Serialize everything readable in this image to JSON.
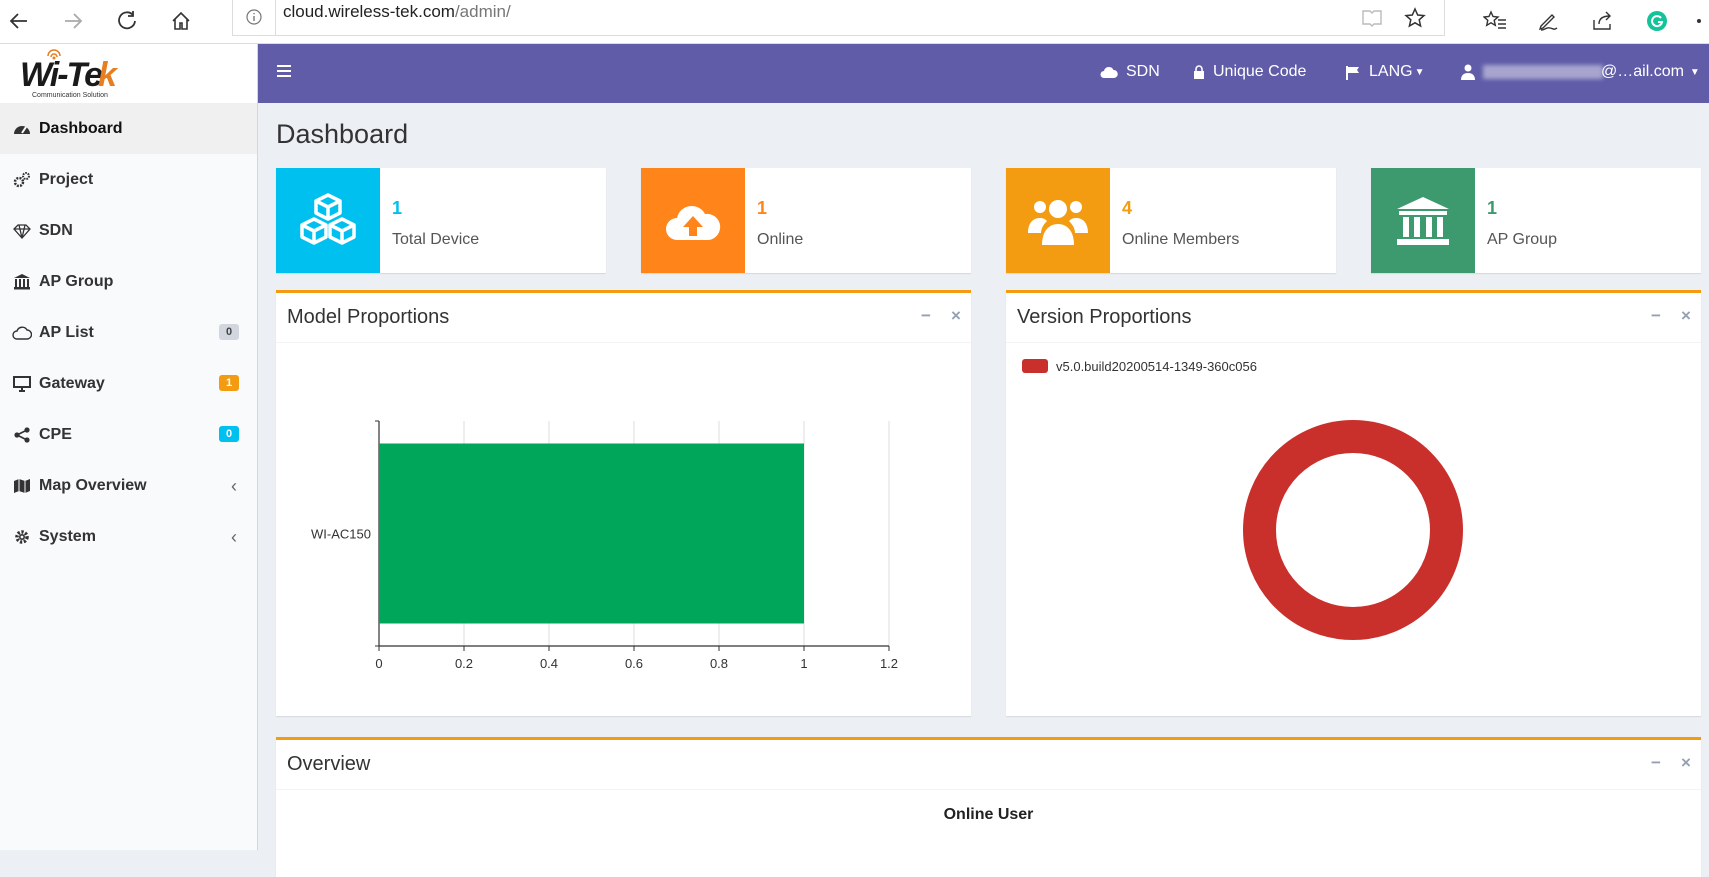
{
  "browser": {
    "url_host": "cloud.wireless-tek.com",
    "url_path": "/admin/"
  },
  "brand": {
    "logo_text": "Wi-Tek",
    "logo_tagline": "Communication Solution"
  },
  "sidebar": {
    "items": [
      {
        "label": "Dashboard",
        "icon": "dashboard-icon"
      },
      {
        "label": "Project",
        "icon": "cogs-icon"
      },
      {
        "label": "SDN",
        "icon": "diamond-icon"
      },
      {
        "label": "AP Group",
        "icon": "bank-icon"
      },
      {
        "label": "AP List",
        "icon": "cloud-outline-icon",
        "badge": "0",
        "badge_color": "#d2d6de"
      },
      {
        "label": "Gateway",
        "icon": "desktop-icon",
        "badge": "1",
        "badge_color": "#f39c12"
      },
      {
        "label": "CPE",
        "icon": "share-icon",
        "badge": "0",
        "badge_color": "#00c0ef"
      },
      {
        "label": "Map Overview",
        "icon": "map-icon",
        "chevron": "‹"
      },
      {
        "label": "System",
        "icon": "gear-icon",
        "chevron": "‹"
      }
    ]
  },
  "topnav": {
    "sdn": "SDN",
    "unique_code": "Unique Code",
    "lang": "LANG",
    "user": "@…ail.com",
    "color": "#605ca8"
  },
  "page": {
    "title": "Dashboard"
  },
  "stats": [
    {
      "value": "1",
      "label": "Total Device",
      "color": "#00c0ef",
      "icon": "cubes-icon"
    },
    {
      "value": "1",
      "label": "Online",
      "color": "#ff851b",
      "icon": "cloud-upload-icon"
    },
    {
      "value": "4",
      "label": "Online Members",
      "color": "#f39c12",
      "icon": "users-icon"
    },
    {
      "value": "1",
      "label": "AP Group",
      "color": "#3c9a6e",
      "icon": "bank-icon"
    }
  ],
  "model_box": {
    "title": "Model Proportions"
  },
  "version_box": {
    "title": "Version Proportions"
  },
  "overview_box": {
    "title": "Overview",
    "subtitle": "Online User"
  },
  "chart_data": [
    {
      "type": "bar",
      "orientation": "horizontal",
      "categories": [
        "WI-AC150"
      ],
      "values": [
        1
      ],
      "xlim": [
        0,
        1.2
      ],
      "xticks": [
        "0",
        "0.2",
        "0.4",
        "0.6",
        "0.8",
        "1",
        "1.2"
      ],
      "grid": true,
      "color": "#00a65a"
    },
    {
      "type": "pie",
      "donut": true,
      "labels": [
        "v5.0.build20200514-1349-360c056"
      ],
      "values": [
        1
      ],
      "colors": [
        "#c9302c"
      ],
      "legend": "top-left"
    }
  ]
}
